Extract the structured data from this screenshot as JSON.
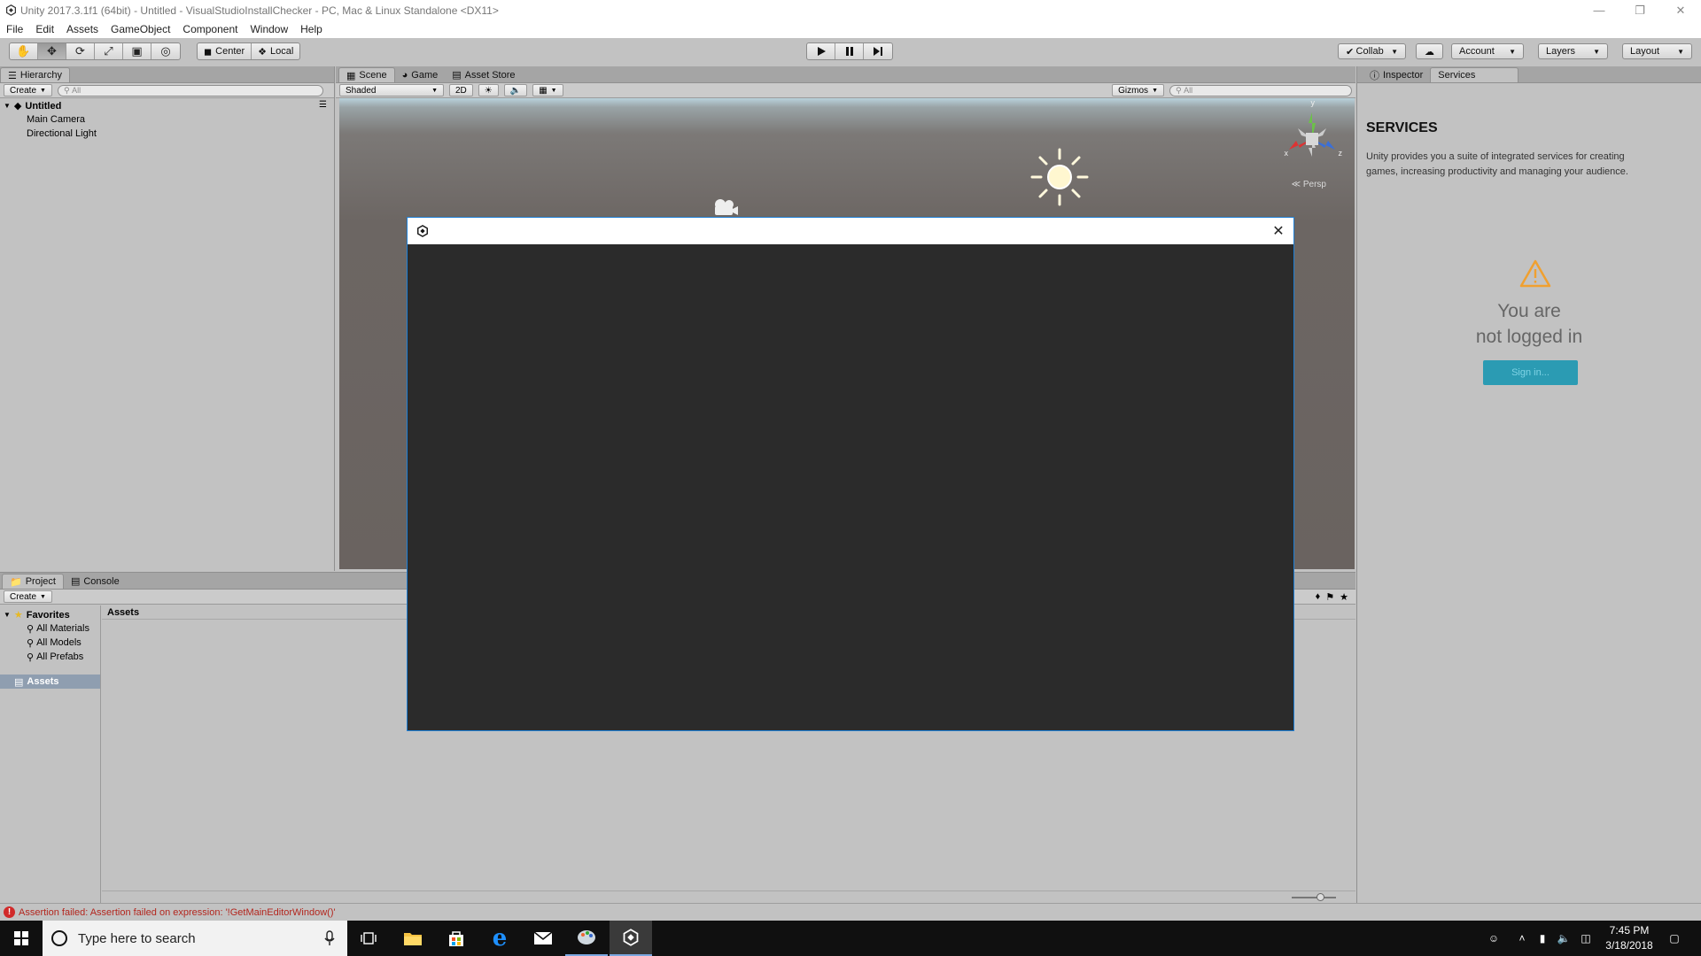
{
  "window": {
    "title": "Unity 2017.3.1f1 (64bit) - Untitled - VisualStudioInstallChecker - PC, Mac & Linux Standalone <DX11>"
  },
  "menu": [
    "File",
    "Edit",
    "Assets",
    "GameObject",
    "Component",
    "Window",
    "Help"
  ],
  "toolbar": {
    "pivot_center": "Center",
    "pivot_local": "Local",
    "collab": "Collab",
    "account": "Account",
    "layers": "Layers",
    "layout": "Layout"
  },
  "hierarchy": {
    "tab": "Hierarchy",
    "create": "Create",
    "search_placeholder": "All",
    "scene_name": "Untitled",
    "items": [
      "Main Camera",
      "Directional Light"
    ]
  },
  "scene": {
    "tabs": [
      "Scene",
      "Game",
      "Asset Store"
    ],
    "shading": "Shaded",
    "mode_2d": "2D",
    "gizmos": "Gizmos",
    "search_placeholder": "All",
    "persp": "Persp",
    "axis_x": "x",
    "axis_y": "y",
    "axis_z": "z"
  },
  "inspector": {
    "tabs": [
      "Inspector",
      "Services"
    ],
    "services_title": "SERVICES",
    "services_desc": "Unity provides you a suite of integrated services for creating games, increasing productivity and managing your audience.",
    "not_logged_line1": "You are",
    "not_logged_line2": "not logged in",
    "signin": "Sign in...",
    "accent": "#2b9bb3",
    "warning_color": "#f0a030"
  },
  "project": {
    "tabs": [
      "Project",
      "Console"
    ],
    "create": "Create",
    "favorites": "Favorites",
    "favorite_items": [
      "All Materials",
      "All Models",
      "All Prefabs"
    ],
    "assets_folder": "Assets",
    "assets_header": "Assets"
  },
  "status": {
    "message": "Assertion failed: Assertion failed on expression: '!GetMainEditorWindow()'",
    "color": "#b3261e"
  },
  "taskbar": {
    "search_placeholder": "Type here to search",
    "time": "7:45 PM",
    "date": "3/18/2018"
  }
}
